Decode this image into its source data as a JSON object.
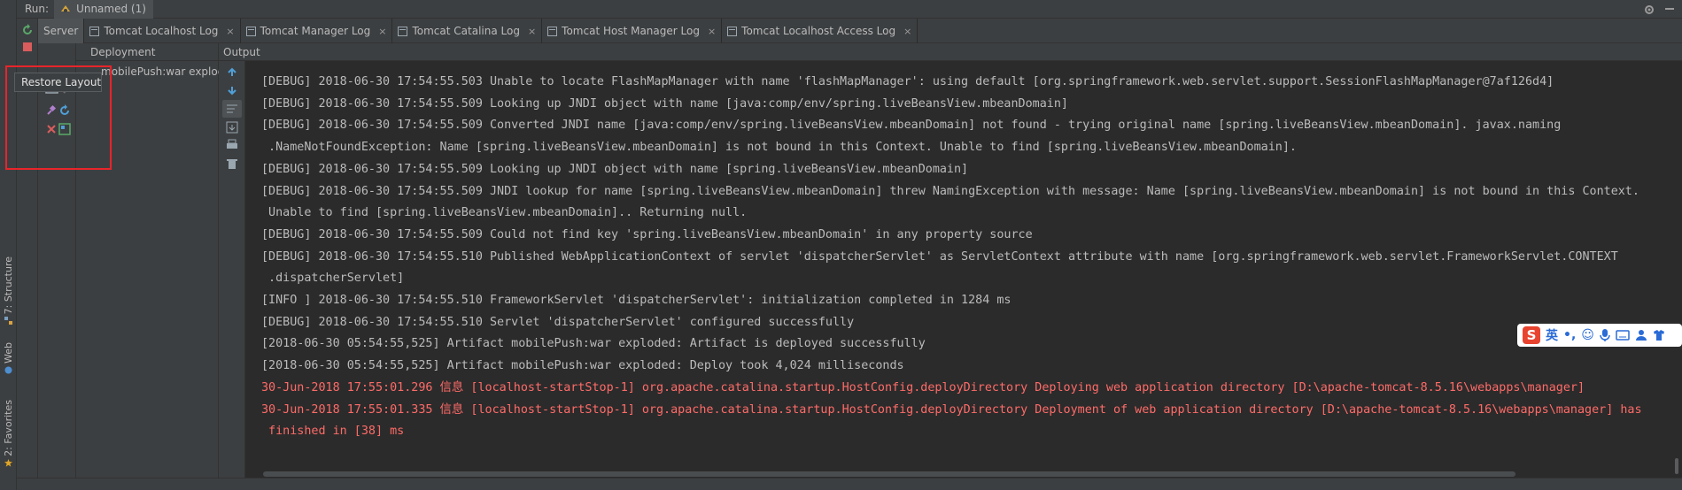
{
  "run_header": {
    "label": "Run:",
    "config_name": "Unnamed (1)"
  },
  "left_stripe": {
    "items": [
      {
        "label": "7: Structure",
        "icon": "structure-icon"
      },
      {
        "label": "Web",
        "icon": "web-icon"
      },
      {
        "label": "2: Favorites",
        "icon": "star-icon"
      }
    ]
  },
  "tabs": [
    {
      "label": "Server",
      "active": true
    },
    {
      "label": "Tomcat Localhost Log"
    },
    {
      "label": "Tomcat Manager Log"
    },
    {
      "label": "Tomcat Catalina Log"
    },
    {
      "label": "Tomcat Host Manager Log"
    },
    {
      "label": "Tomcat Localhost Access Log"
    }
  ],
  "server_panel": {
    "deployment_header": "Deployment",
    "deployment_item": "mobilePush:war exploded"
  },
  "output": {
    "header": "Output",
    "lines": [
      {
        "text": "[DEBUG] 2018-06-30 17:54:55.503 Unable to locate FlashMapManager with name 'flashMapManager': using default [org.springframework.web.servlet.support.SessionFlashMapManager@7af126d4]",
        "type": "normal"
      },
      {
        "text": "[DEBUG] 2018-06-30 17:54:55.509 Looking up JNDI object with name [java:comp/env/spring.liveBeansView.mbeanDomain]",
        "type": "normal"
      },
      {
        "text": "[DEBUG] 2018-06-30 17:54:55.509 Converted JNDI name [java:comp/env/spring.liveBeansView.mbeanDomain] not found - trying original name [spring.liveBeansView.mbeanDomain]. javax.naming",
        "type": "normal"
      },
      {
        "text": " .NameNotFoundException: Name [spring.liveBeansView.mbeanDomain] is not bound in this Context. Unable to find [spring.liveBeansView.mbeanDomain].",
        "type": "normal"
      },
      {
        "text": "[DEBUG] 2018-06-30 17:54:55.509 Looking up JNDI object with name [spring.liveBeansView.mbeanDomain]",
        "type": "normal"
      },
      {
        "text": "[DEBUG] 2018-06-30 17:54:55.509 JNDI lookup for name [spring.liveBeansView.mbeanDomain] threw NamingException with message: Name [spring.liveBeansView.mbeanDomain] is not bound in this Context.",
        "type": "normal"
      },
      {
        "text": " Unable to find [spring.liveBeansView.mbeanDomain].. Returning null.",
        "type": "normal"
      },
      {
        "text": "[DEBUG] 2018-06-30 17:54:55.509 Could not find key 'spring.liveBeansView.mbeanDomain' in any property source",
        "type": "normal"
      },
      {
        "text": "[DEBUG] 2018-06-30 17:54:55.510 Published WebApplicationContext of servlet 'dispatcherServlet' as ServletContext attribute with name [org.springframework.web.servlet.FrameworkServlet.CONTEXT",
        "type": "normal"
      },
      {
        "text": " .dispatcherServlet]",
        "type": "normal"
      },
      {
        "text": "[INFO ] 2018-06-30 17:54:55.510 FrameworkServlet 'dispatcherServlet': initialization completed in 1284 ms",
        "type": "normal"
      },
      {
        "text": "[DEBUG] 2018-06-30 17:54:55.510 Servlet 'dispatcherServlet' configured successfully",
        "type": "normal"
      },
      {
        "text": "[2018-06-30 05:54:55,525] Artifact mobilePush:war exploded: Artifact is deployed successfully",
        "type": "normal"
      },
      {
        "text": "[2018-06-30 05:54:55,525] Artifact mobilePush:war exploded: Deploy took 4,024 milliseconds",
        "type": "normal"
      },
      {
        "text": "30-Jun-2018 17:55:01.296 信息 [localhost-startStop-1] org.apache.catalina.startup.HostConfig.deployDirectory Deploying web application directory [D:\\apache-tomcat-8.5.16\\webapps\\manager]",
        "type": "error"
      },
      {
        "text": "30-Jun-2018 17:55:01.335 信息 [localhost-startStop-1] org.apache.catalina.startup.HostConfig.deployDirectory Deployment of web application directory [D:\\apache-tomcat-8.5.16\\webapps\\manager] has",
        "type": "error"
      },
      {
        "text": " finished in [38] ms",
        "type": "error"
      }
    ]
  },
  "tooltip": {
    "text": "Restore Layout"
  },
  "ime_bar": {
    "label": "英"
  },
  "colors": {
    "highlight": "#e8242b",
    "error_text": "#ff6b68",
    "background": "#2b2b2b",
    "panel": "#3c3f41"
  }
}
